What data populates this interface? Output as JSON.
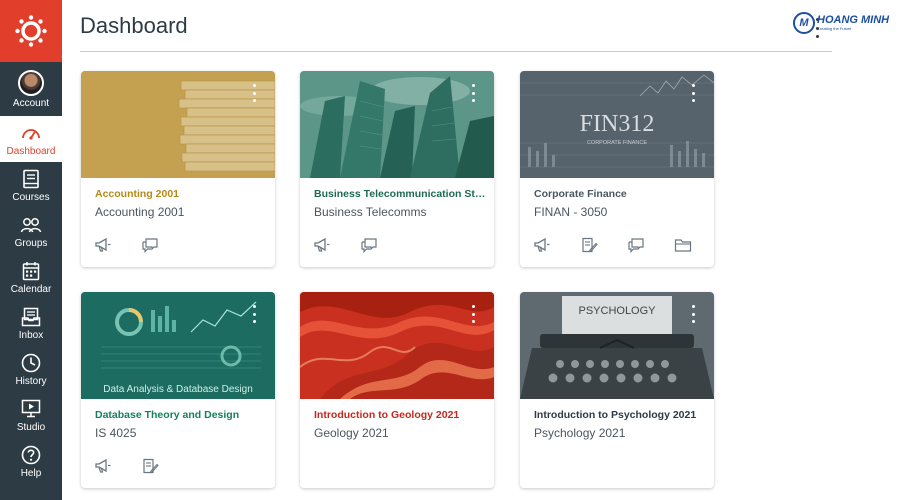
{
  "nav": {
    "items": [
      {
        "label": "Account",
        "icon": "avatar"
      },
      {
        "label": "Dashboard",
        "icon": "dashboard-icon"
      },
      {
        "label": "Courses",
        "icon": "courses-icon"
      },
      {
        "label": "Groups",
        "icon": "groups-icon"
      },
      {
        "label": "Calendar",
        "icon": "calendar-icon"
      },
      {
        "label": "Inbox",
        "icon": "inbox-icon"
      },
      {
        "label": "History",
        "icon": "history-icon"
      },
      {
        "label": "Studio",
        "icon": "studio-icon"
      },
      {
        "label": "Help",
        "icon": "help-icon"
      }
    ],
    "colors": {
      "bg": "#2d3b45",
      "brand": "#e13f2b",
      "active_bg": "#ffffff"
    }
  },
  "header": {
    "title": "Dashboard"
  },
  "brand": {
    "name": "HOANG MINH",
    "tagline": "Creating the Future"
  },
  "cards": [
    {
      "title": "Accounting 2001",
      "subtitle": "Accounting 2001",
      "color": "#b58a1d",
      "actions": [
        "announcements-icon",
        "discussions-icon"
      ]
    },
    {
      "title": "Business Telecommunication Strat...",
      "subtitle": "Business Telecomms",
      "color": "#1e6b4f",
      "actions": [
        "announcements-icon",
        "discussions-icon"
      ]
    },
    {
      "title": "Corporate Finance",
      "subtitle": "FINAN - 3050",
      "color": "#4a5660",
      "hero_text": "FIN312",
      "hero_sub": "CORPORATE FINANCE",
      "actions": [
        "announcements-icon",
        "assignments-icon",
        "discussions-icon",
        "files-icon"
      ]
    },
    {
      "title": "Database Theory and Design",
      "subtitle": "IS 4025",
      "color": "#14805e",
      "hero_text": "Data Analysis & Database Design",
      "actions": [
        "announcements-icon",
        "assignments-icon"
      ]
    },
    {
      "title": "Introduction to Geology 2021",
      "subtitle": "Geology 2021",
      "color": "#c5281c",
      "actions": []
    },
    {
      "title": "Introduction to Psychology 2021",
      "subtitle": "Psychology 2021",
      "color": "#2d3b45",
      "hero_text": "PSYCHOLOGY",
      "actions": []
    }
  ]
}
